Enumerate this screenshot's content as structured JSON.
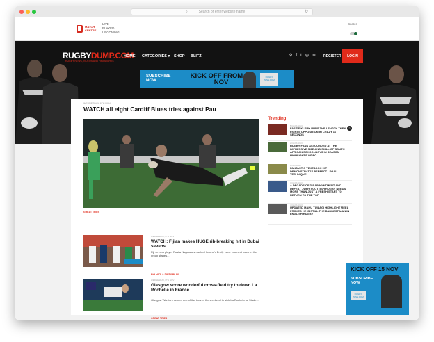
{
  "browser": {
    "url_placeholder": "Search or enter website name",
    "lock_glyph": "🔒",
    "reload_glyph": "↻",
    "dots": [
      "#fc5f57",
      "#fdbc2e",
      "#28c840"
    ]
  },
  "topbar": {
    "brand_line1": "MATCH",
    "brand_line2": "CENTRE",
    "menu": [
      "LIVE",
      "PLAYED",
      "UPCOMING"
    ],
    "scores_label": "Scores"
  },
  "nav": {
    "logo_main": "RUGBY",
    "logo_accent": "DUMP.COM",
    "logo_tagline": "RUGBY NEWS, VIDEOS AND HIGHLIGHTS",
    "items": [
      "HOME",
      "CATEGORIES ▾",
      "SHOP",
      "BLITZ"
    ],
    "register": "REGISTER",
    "login": "LOGIN",
    "accent_color": "#e02a1a"
  },
  "ad_top": {
    "subscribe": "SUBSCRIBE NOW",
    "kick_off": "KICK OFF FROM 15 NOV",
    "brand": "RUGBY PASS.COM"
  },
  "main_story": {
    "date": "WEDNESDAY, 6TH NOV",
    "title": "WATCH all eight Cardiff Blues tries against Pau",
    "tag": "GREAT TRIES"
  },
  "trending": {
    "label": "Trending",
    "items": [
      {
        "date": "5 DAYS AGO",
        "title": "FAF DE KLERK RUNS THE LENGTH THEN FIGHTS OPPOSITION IN CRAZY 16 SECONDS",
        "badge": "2"
      },
      {
        "date": "2 DAYS AGO",
        "title": "RUGBY FANS ASTOUNDED AT THE IMPRESSIVE SIZE AND SKILL OF SOUTH AFRICAN SCHOOLBOYS IN SEASON HIGHLIGHTS VIDEO"
      },
      {
        "date": "1 DAY AGO",
        "title": "FANTASTIC TEXTBOOK HIT DEMONSTRATES PERFECT LEGAL TECHNIQUE"
      },
      {
        "date": "3 DAYS AGO",
        "title": "A DECADE OF DISAPPOINTMENT AND DEFEAT - WHY SCOTTISH RUGBY NEEDS MORE THAN JUST A FRESH START TO RETURN TO THE TOP"
      },
      {
        "date": "4 DAYS AGO",
        "title": "UPDATED MANU TUILAGI HIGHLIGHT REEL PROVES HE IS STILL THE BADDEST MAN IN ENGLISH RUGBY"
      }
    ]
  },
  "articles": [
    {
      "date": "WEDNESDAY, 6TH NOV",
      "title": "WATCH: Fijian makes HUGE rib-breaking hit in Dubai sevens",
      "summary": "Fiji sevens player Rusila Nagasau smashed Ireland's Emily Lane into next week in the group stages...",
      "tag": "BIG HITS & DIRTY PLAY"
    },
    {
      "date": "WEDNESDAY, 6TH NOV",
      "title": "Glasgow score wonderful cross-field try to down La Rochelle in France",
      "summary": "Glasgow Warriors scored one of the tries of the weekend to sink La Rochelle at Stade...",
      "tag": "GREAT TRIES"
    }
  ],
  "ad_side": {
    "kick_off": "KICK OFF 15 NOV",
    "subscribe": "SUBSCRIBE NOW",
    "brand": "RUGBY PASS.COM"
  },
  "icons": [
    "search-icon",
    "facebook-icon",
    "twitter-icon",
    "instagram-icon",
    "rss-icon"
  ]
}
